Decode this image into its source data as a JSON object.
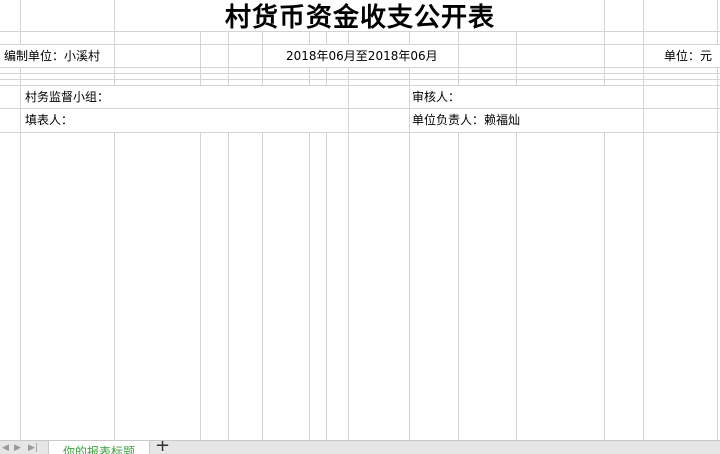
{
  "sheet": {
    "title": "村货币资金收支公开表",
    "compiler_label": "编制单位：小溪村",
    "period": "2018年06月至2018年06月",
    "unit_label": "单位：元",
    "supervision_label": "村务监督小组：",
    "reviewer_label": "审核人：",
    "filler_label": "填表人：",
    "responsible_label": "单位负责人：赖福灿"
  },
  "tabs": {
    "active_label": "你的报表标题",
    "add_symbol": "+"
  },
  "icons": {
    "nav_prev": "triangle-left-icon",
    "nav_next": "triangle-right-icon",
    "nav_last": "last-sheet-icon"
  },
  "colors": {
    "gridline": "#d4d4d4",
    "tab_text": "#3f9f3f",
    "tabbar": "#e6e6e6"
  }
}
